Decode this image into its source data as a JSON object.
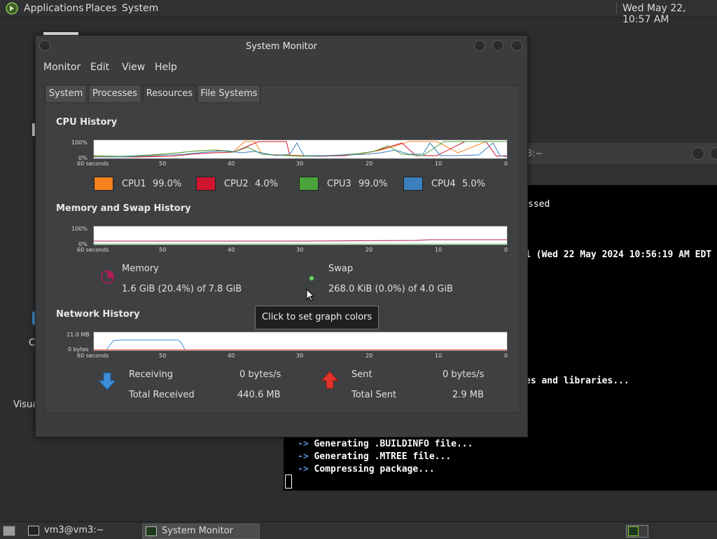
{
  "top_panel": {
    "menus": [
      "Applications",
      "Places",
      "System"
    ],
    "clock": "Wed May 22, 10:57 AM"
  },
  "desktop": {
    "fragments": [
      "C",
      "Visua"
    ]
  },
  "terminal": {
    "title_fragment": "3:~",
    "lines_upper": [
      "ssed",
      "1 (Wed 22 May 2024 10:56:19 AM EDT",
      "es and libraries..."
    ],
    "lines_lower": [
      {
        "arrow": "->",
        "text": "Generating .BUILDINFO file..."
      },
      {
        "arrow": "->",
        "text": "Generating .MTREE file..."
      },
      {
        "arrow": "->",
        "text": "Compressing package..."
      }
    ]
  },
  "window": {
    "title": "System Monitor",
    "menu": [
      "Monitor",
      "Edit",
      "View",
      "Help"
    ],
    "tabs": [
      "System",
      "Processes",
      "Resources",
      "File Systems"
    ],
    "active_tab": "Resources"
  },
  "cpu": {
    "title": "CPU History",
    "y_top": "100%",
    "y_bottom": "0%",
    "x_labels": [
      "60 seconds",
      "50",
      "40",
      "30",
      "20",
      "10",
      "0"
    ],
    "legend": [
      {
        "label": "CPU1",
        "value": "99.0%",
        "color": "#f5821f"
      },
      {
        "label": "CPU2",
        "value": "4.0%",
        "color": "#d0152e"
      },
      {
        "label": "CPU3",
        "value": "99.0%",
        "color": "#4aa33a"
      },
      {
        "label": "CPU4",
        "value": "5.0%",
        "color": "#3c7fbd"
      }
    ]
  },
  "memory": {
    "title": "Memory and Swap History",
    "y_top": "100%",
    "y_bottom": "0%",
    "x_labels": [
      "60 seconds",
      "50",
      "40",
      "30",
      "20",
      "10",
      "0"
    ],
    "mem_label": "Memory",
    "mem_value": "1.6 GiB (20.4%) of 7.8 GiB",
    "mem_color": "#b01e58",
    "swap_label": "Swap",
    "swap_value": "268.0 KiB (0.0%) of 4.0 GiB",
    "swap_color": "#6fcf6a"
  },
  "network": {
    "title": "Network History",
    "y_top": "21.0 MB",
    "y_bottom": "0 bytes",
    "x_labels": [
      "60 seconds",
      "50",
      "40",
      "30",
      "20",
      "10",
      "0"
    ],
    "receiving_label": "Receiving",
    "receiving_value": "0 bytes/s",
    "total_received_label": "Total Received",
    "total_received_value": "440.6 MB",
    "sent_label": "Sent",
    "sent_value": "0 bytes/s",
    "total_sent_label": "Total Sent",
    "total_sent_value": "2.9 MB",
    "receive_color": "#3c8ed8",
    "send_color": "#e0342a"
  },
  "tooltip": "Click to set graph colors",
  "taskbar": {
    "items": [
      "vm3@vm3:~",
      "System Monitor"
    ],
    "active": "System Monitor"
  }
}
